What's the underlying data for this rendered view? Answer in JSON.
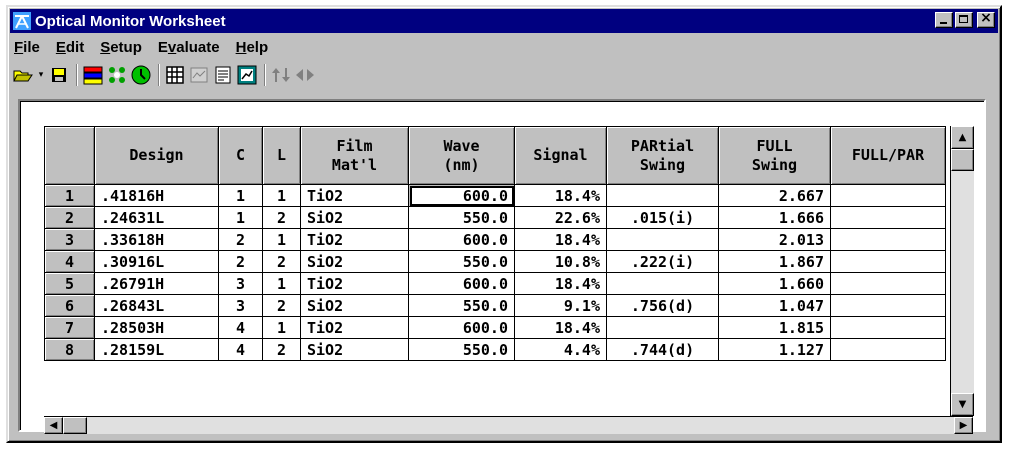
{
  "window": {
    "title": "Optical Monitor Worksheet"
  },
  "menu": [
    {
      "label": "File",
      "key": "F",
      "rest": "ile"
    },
    {
      "label": "Edit",
      "key": "E",
      "rest": "dit"
    },
    {
      "label": "Setup",
      "key": "S",
      "rest": "etup"
    },
    {
      "label": "Evaluate",
      "pre": "E",
      "key": "v",
      "rest": "aluate"
    },
    {
      "label": "Help",
      "key": "H",
      "rest": "elp"
    }
  ],
  "toolbar_icons": [
    "open-folder-icon",
    "save-disk-icon",
    "color-bars-icon",
    "circles-icon",
    "clock-icon",
    "grid-table-icon",
    "chart-icon",
    "document-icon",
    "plot-icon",
    "up-down-arrows-icon",
    "left-right-arrows-icon"
  ],
  "table": {
    "headers": [
      {
        "line1": "",
        "line2": ""
      },
      {
        "line1": "Design",
        "line2": ""
      },
      {
        "line1": "C",
        "line2": ""
      },
      {
        "line1": "L",
        "line2": ""
      },
      {
        "line1": "Film",
        "line2": "Mat'l"
      },
      {
        "line1": "Wave",
        "line2": "(nm)"
      },
      {
        "line1": "Signal",
        "line2": ""
      },
      {
        "line1": "PARtial",
        "line2": "Swing"
      },
      {
        "line1": "FULL",
        "line2": "Swing"
      },
      {
        "line1": "FULL/PAR",
        "line2": ""
      }
    ],
    "rows": [
      {
        "n": "1",
        "design": ".41816H",
        "c": "1",
        "l": "1",
        "film": "TiO2",
        "wave": "600.0",
        "signal": "18.4%",
        "partial": "",
        "full": "2.667",
        "ratio": ""
      },
      {
        "n": "2",
        "design": ".24631L",
        "c": "1",
        "l": "2",
        "film": "SiO2",
        "wave": "550.0",
        "signal": "22.6%",
        "partial": ".015(i)",
        "full": "1.666",
        "ratio": ""
      },
      {
        "n": "3",
        "design": ".33618H",
        "c": "2",
        "l": "1",
        "film": "TiO2",
        "wave": "600.0",
        "signal": "18.4%",
        "partial": "",
        "full": "2.013",
        "ratio": ""
      },
      {
        "n": "4",
        "design": ".30916L",
        "c": "2",
        "l": "2",
        "film": "SiO2",
        "wave": "550.0",
        "signal": "10.8%",
        "partial": ".222(i)",
        "full": "1.867",
        "ratio": ""
      },
      {
        "n": "5",
        "design": ".26791H",
        "c": "3",
        "l": "1",
        "film": "TiO2",
        "wave": "600.0",
        "signal": "18.4%",
        "partial": "",
        "full": "1.660",
        "ratio": ""
      },
      {
        "n": "6",
        "design": ".26843L",
        "c": "3",
        "l": "2",
        "film": "SiO2",
        "wave": "550.0",
        "signal": "9.1%",
        "partial": ".756(d)",
        "full": "1.047",
        "ratio": ""
      },
      {
        "n": "7",
        "design": ".28503H",
        "c": "4",
        "l": "1",
        "film": "TiO2",
        "wave": "600.0",
        "signal": "18.4%",
        "partial": "",
        "full": "1.815",
        "ratio": ""
      },
      {
        "n": "8",
        "design": ".28159L",
        "c": "4",
        "l": "2",
        "film": "SiO2",
        "wave": "550.0",
        "signal": "4.4%",
        "partial": ".744(d)",
        "full": "1.127",
        "ratio": ""
      }
    ]
  },
  "colors": {
    "titlebar": "#000080",
    "face": "#c0c0c0"
  }
}
